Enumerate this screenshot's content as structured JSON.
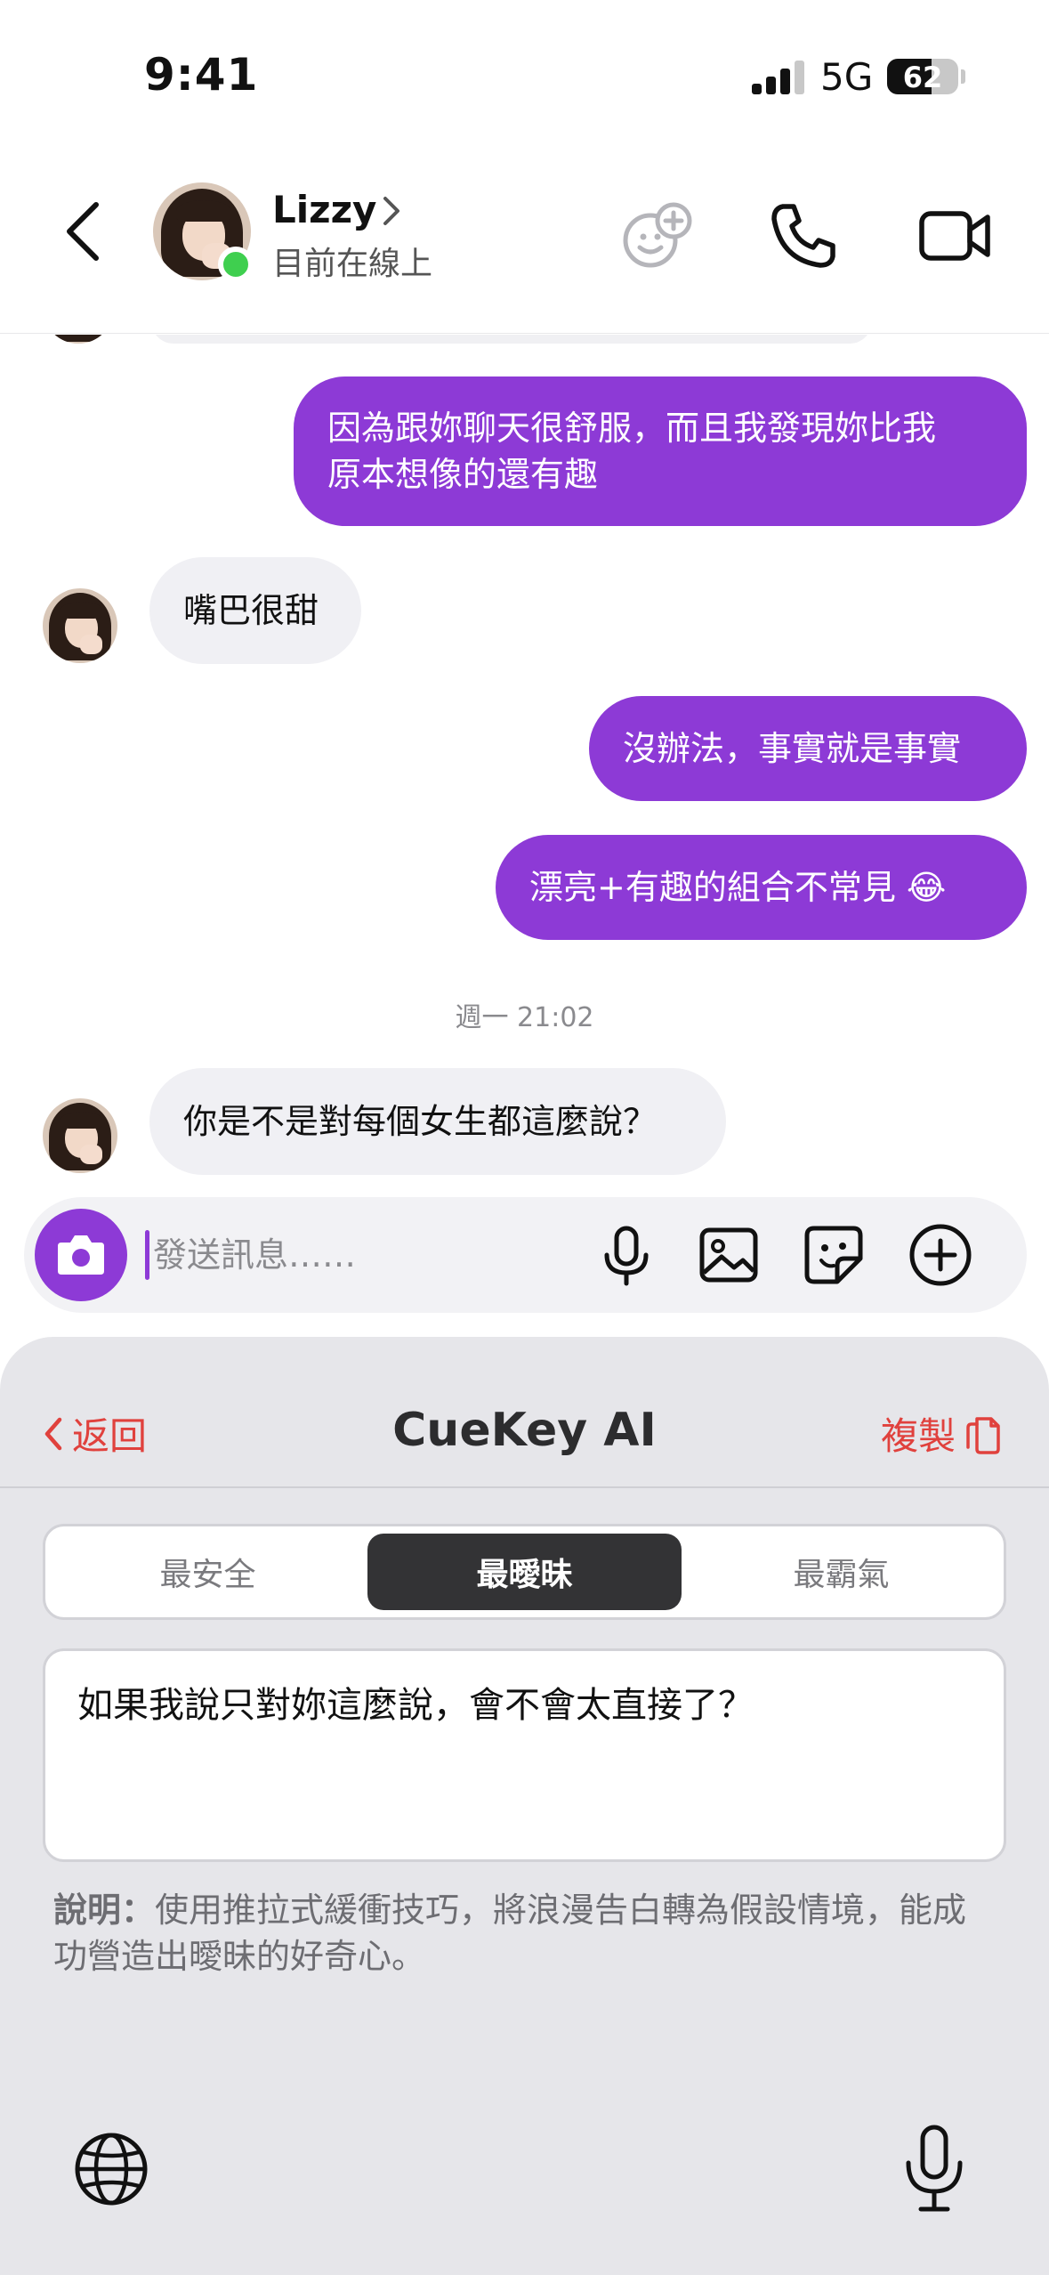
{
  "status_bar": {
    "time": "9:41",
    "network": "5G",
    "battery": "62",
    "battery_level": 0.62
  },
  "header": {
    "contact_name": "Lizzy",
    "contact_status": "目前在線上"
  },
  "messages": [
    {
      "direction": "out",
      "lines": [
        "因為跟妳聊天很舒服，而且我發現妳比我",
        "原本想像的還有趣"
      ]
    },
    {
      "direction": "in",
      "text": "嘴巴很甜"
    },
    {
      "direction": "out",
      "text": "沒辦法，事實就是事實"
    },
    {
      "direction": "out",
      "text": "漂亮+有趣的組合不常見 😂"
    },
    {
      "direction": "in",
      "text": "你是不是對每個女生都這麼說？"
    }
  ],
  "timestamp": "週一 21:02",
  "composer": {
    "placeholder": "發送訊息……"
  },
  "ai_panel": {
    "back_label": "返回",
    "title": "CueKey AI",
    "copy_label": "複製",
    "tabs": [
      "最安全",
      "最曖昧",
      "最霸氣"
    ],
    "selected_tab": "最曖昧",
    "suggestion": "如果我說只對妳這麼說，會不會太直接了？",
    "explanation_label": "說明：",
    "explanation_text": "使用推拉式緩衝技巧，將浪漫告白轉為假設情境，能成功營造出曖昧的好奇心。"
  },
  "colors": {
    "accent_purple": "#8d3ad6",
    "accent_red": "#e0413d",
    "online_green": "#3fcf4f"
  }
}
